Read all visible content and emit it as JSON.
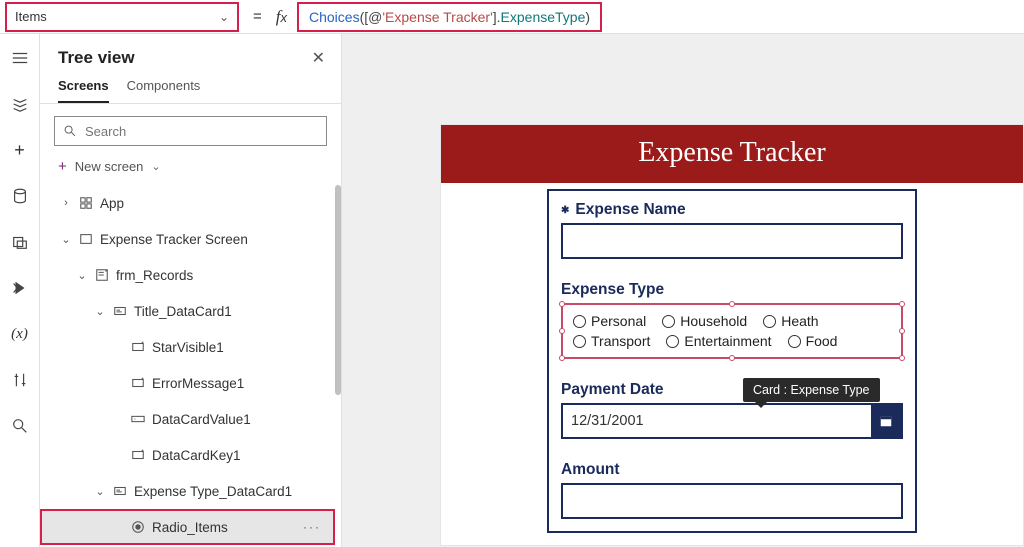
{
  "formula": {
    "property": "Items",
    "fn": "Choices",
    "op_open": "([@",
    "str": "'Expense Tracker'",
    "op_close": "].",
    "id": "ExpenseType",
    "paren_close": ")"
  },
  "panel": {
    "title": "Tree view",
    "tabs": {
      "screens": "Screens",
      "components": "Components"
    },
    "search_placeholder": "Search",
    "new_screen": "New screen"
  },
  "tree": {
    "app": "App",
    "screen": "Expense Tracker Screen",
    "form": "frm_Records",
    "title_card": "Title_DataCard1",
    "star": "StarVisible1",
    "err": "ErrorMessage1",
    "val": "DataCardValue1",
    "key": "DataCardKey1",
    "type_card": "Expense Type_DataCard1",
    "radio": "Radio_Items"
  },
  "app": {
    "title": "Expense Tracker",
    "tooltip": "Card : Expense Type",
    "labels": {
      "name": "Expense Name",
      "type": "Expense Type",
      "date": "Payment Date",
      "amount": "Amount"
    },
    "radio": [
      "Personal",
      "Household",
      "Heath",
      "Transport",
      "Entertainment",
      "Food"
    ],
    "date_value": "12/31/2001"
  }
}
